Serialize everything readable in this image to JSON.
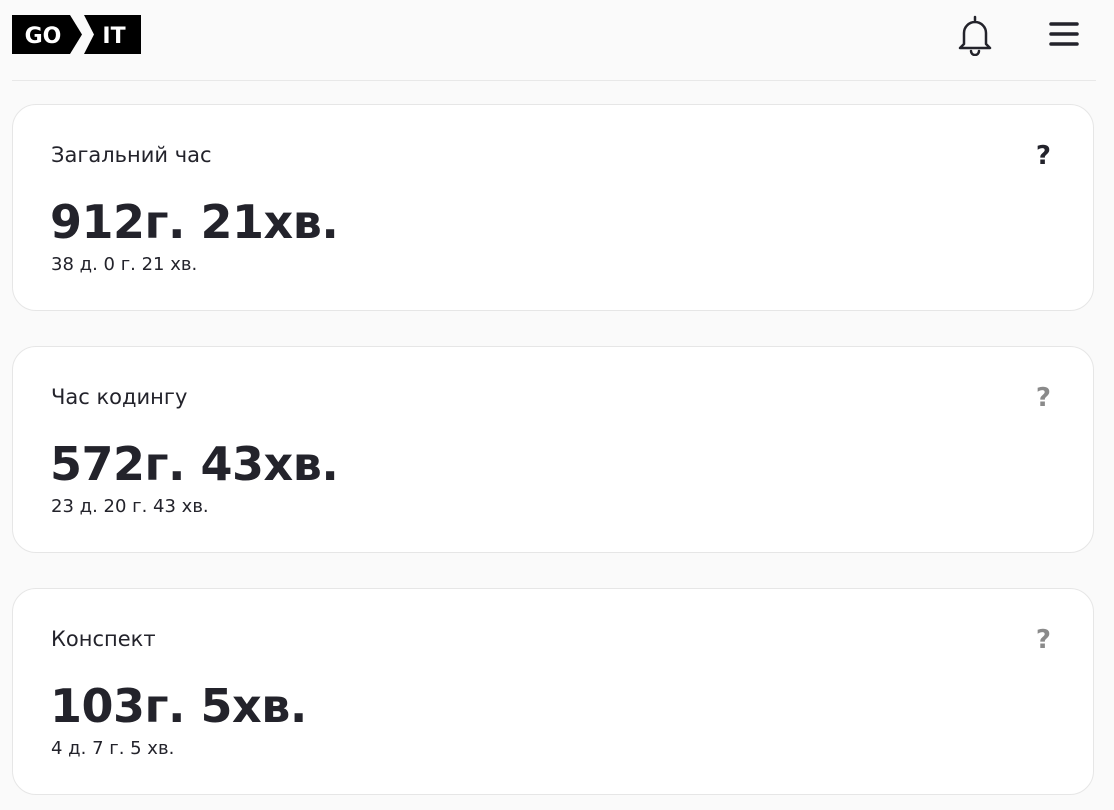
{
  "header": {
    "logo_left": "GO",
    "logo_right": "IT"
  },
  "cards": [
    {
      "title": "Загальний час",
      "value": "912г. 21хв.",
      "detail": "38 д. 0 г. 21 хв.",
      "help": "?"
    },
    {
      "title": "Час кодингу",
      "value": "572г. 43хв.",
      "detail": "23 д. 20 г. 43 хв.",
      "help": "?"
    },
    {
      "title": "Конспект",
      "value": "103г. 5хв.",
      "detail": "4 д. 7 г. 5 хв.",
      "help": "?"
    }
  ]
}
